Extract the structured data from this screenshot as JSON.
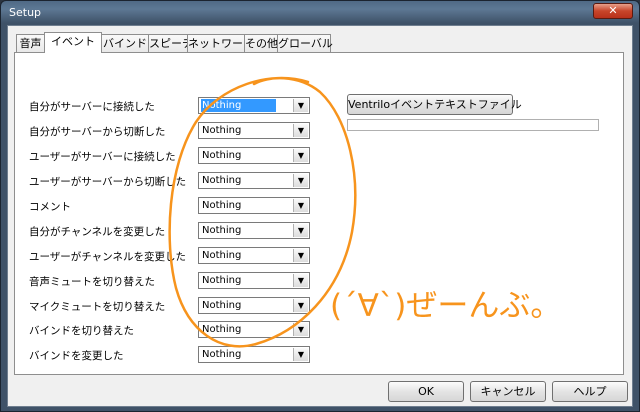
{
  "window": {
    "title": "Setup",
    "close_symbol": "✕"
  },
  "tabs": [
    {
      "label": "音声"
    },
    {
      "label": "イベント"
    },
    {
      "label": "バインド"
    },
    {
      "label": "スピーチ"
    },
    {
      "label": "ネットワーク"
    },
    {
      "label": "その他"
    },
    {
      "label": "グローバル"
    }
  ],
  "active_tab": "イベント",
  "events": [
    {
      "label": "自分がサーバーに接続した",
      "value": "Nothing"
    },
    {
      "label": "自分がサーバーから切断した",
      "value": "Nothing"
    },
    {
      "label": "ユーザーがサーバーに接続した",
      "value": "Nothing"
    },
    {
      "label": "ユーザーがサーバーから切断した",
      "value": "Nothing"
    },
    {
      "label": "コメント",
      "value": "Nothing"
    },
    {
      "label": "自分がチャンネルを変更した",
      "value": "Nothing"
    },
    {
      "label": "ユーザーがチャンネルを変更した",
      "value": "Nothing"
    },
    {
      "label": "音声ミュートを切り替えた",
      "value": "Nothing"
    },
    {
      "label": "マイクミュートを切り替えた",
      "value": "Nothing"
    },
    {
      "label": "バインドを切り替えた",
      "value": "Nothing"
    },
    {
      "label": "バインドを変更した",
      "value": "Nothing"
    }
  ],
  "event_file_button": "Ventriloイベントテキストファイル",
  "event_file_path": "",
  "annotation": {
    "text": "(´∀`)ぜーんぶ。",
    "color": "#f7941d"
  },
  "footer": {
    "ok": "OK",
    "cancel": "キャンセル",
    "help": "ヘルプ"
  }
}
